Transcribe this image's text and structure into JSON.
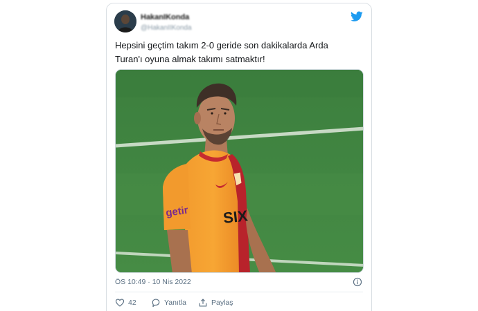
{
  "tweet": {
    "display_name": "HakanIKonda",
    "handle": "@HakanIIKonda",
    "text_line1": "Hepsini geçtim takım 2-0 geride son dakikalarda Arda",
    "text_line2": "Turan'ı oyuna almak takımı satmaktır!",
    "timestamp": "ÖS 10:49 · 10 Nis 2022",
    "likes": "42",
    "reply_label": "Yanıtla",
    "share_label": "Paylaş"
  },
  "media": {
    "jersey_sponsor_sleeve": "getir",
    "jersey_sponsor_chest": "SIX"
  },
  "colors": {
    "twitter_blue": "#1d9bf0",
    "pitch_green": "#3f8540",
    "jersey_orange": "#f39a2a",
    "jersey_red": "#b8232b",
    "muted_text": "#5b7083"
  },
  "icons": [
    "twitter-bird-icon",
    "info-icon",
    "heart-icon",
    "reply-icon",
    "share-icon"
  ]
}
